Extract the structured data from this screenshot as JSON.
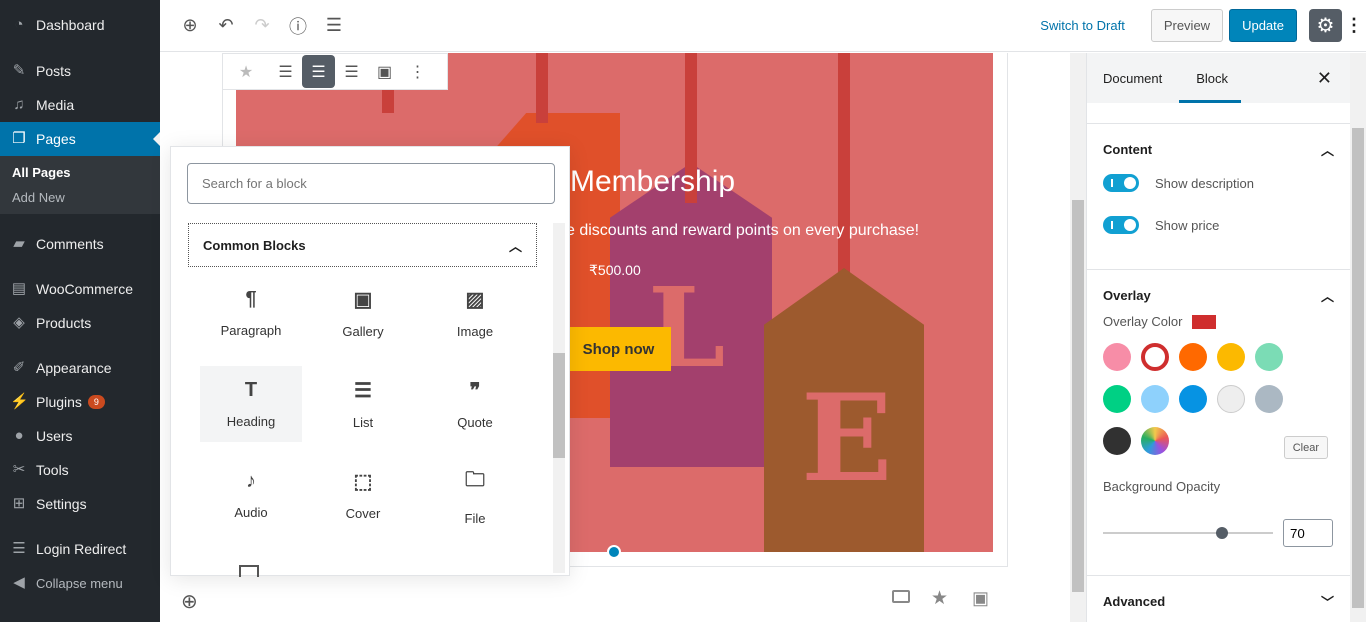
{
  "sidebar": {
    "items": [
      {
        "label": "Dashboard",
        "icon": "dashboard-icon"
      },
      {
        "label": "Posts",
        "icon": "pin-icon"
      },
      {
        "label": "Media",
        "icon": "media-icon"
      },
      {
        "label": "Pages",
        "icon": "pages-icon"
      },
      {
        "label": "Comments",
        "icon": "comment-icon"
      },
      {
        "label": "WooCommerce",
        "icon": "woo-icon"
      },
      {
        "label": "Products",
        "icon": "box-icon"
      },
      {
        "label": "Appearance",
        "icon": "brush-icon"
      },
      {
        "label": "Plugins",
        "icon": "plugin-icon",
        "badge": "9"
      },
      {
        "label": "Users",
        "icon": "user-icon"
      },
      {
        "label": "Tools",
        "icon": "wrench-icon"
      },
      {
        "label": "Settings",
        "icon": "settings-icon"
      },
      {
        "label": "Login Redirect",
        "icon": "list-icon"
      },
      {
        "label": "Collapse menu",
        "icon": "collapse-icon"
      }
    ],
    "submenu": [
      "All Pages",
      "Add New"
    ]
  },
  "topbar": {
    "switch_draft": "Switch to Draft",
    "preview": "Preview",
    "update": "Update"
  },
  "cover": {
    "title": "Membership",
    "description": "e discounts and reward points on every purchase!",
    "price": "₹500.00",
    "button": "Shop now",
    "letters": [
      "L",
      "E"
    ]
  },
  "inserter": {
    "search_placeholder": "Search for a block",
    "panel": "Common Blocks",
    "blocks": [
      {
        "label": "Paragraph",
        "icon": "¶"
      },
      {
        "label": "Gallery",
        "icon": "▣"
      },
      {
        "label": "Image",
        "icon": "▨"
      },
      {
        "label": "Heading",
        "icon": "T"
      },
      {
        "label": "List",
        "icon": "☰"
      },
      {
        "label": "Quote",
        "icon": "❞"
      },
      {
        "label": "Audio",
        "icon": "♪"
      },
      {
        "label": "Cover",
        "icon": "⬚"
      },
      {
        "label": "File",
        "icon": "🗀"
      }
    ]
  },
  "settings": {
    "tabs": [
      "Document",
      "Block"
    ],
    "active_tab": "Block",
    "content": {
      "title": "Content",
      "toggles": [
        {
          "label": "Show description",
          "on": true
        },
        {
          "label": "Show price",
          "on": true
        }
      ]
    },
    "overlay": {
      "title": "Overlay",
      "color_label": "Overlay Color",
      "current_color": "#cf2e2e",
      "palette": [
        "#f78da7",
        "#cf2e2e",
        "#ff6900",
        "#fcb900",
        "#7bdcb5",
        "#00d084",
        "#8ed1fc",
        "#0693e3",
        "#eeeeee",
        "#abb8c3",
        "#313131",
        "gradient"
      ],
      "clear": "Clear",
      "opacity_label": "Background Opacity",
      "opacity": 70
    },
    "advanced": "Advanced"
  }
}
